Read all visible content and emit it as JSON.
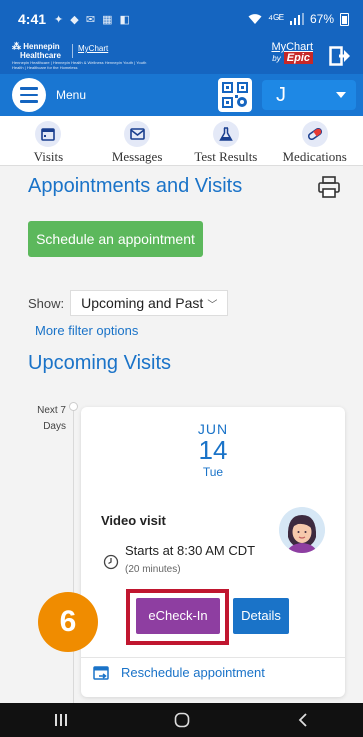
{
  "status_bar": {
    "time": "4:41",
    "notification_glyphs": "✦ ◆ ✉ ▦ ◧",
    "network": "⁴ᴳᴱ",
    "battery": "67%"
  },
  "brand": {
    "org_name_line1": "Hennepin",
    "org_name_line2": "Healthcare",
    "mychart_link": "MyChart",
    "tagline": "Hennepin Healthcare | Hennepin Health & Wellness Hennepin Youth | Youth Health | Healthcare for the Homeless",
    "mychart_logo_text": "MyChart",
    "mychart_logo_by": "by",
    "mychart_logo_epic": "Epic"
  },
  "menu_bar": {
    "menu_label": "Menu",
    "user_initial": "J"
  },
  "shortcuts": [
    {
      "label": "Visits",
      "icon": "calendar-icon"
    },
    {
      "label": "Messages",
      "icon": "envelope-icon"
    },
    {
      "label": "Test Results",
      "icon": "flask-icon"
    },
    {
      "label": "Medications",
      "icon": "pill-icon"
    }
  ],
  "page": {
    "title": "Appointments and Visits",
    "schedule_button": "Schedule an appointment",
    "show_label": "Show:",
    "show_value": "Upcoming and Past",
    "filter_link": "More filter options",
    "upcoming_title": "Upcoming Visits"
  },
  "timeline": {
    "label_line1": "Next 7",
    "label_line2": "Days"
  },
  "visit": {
    "month": "JUN",
    "day": "14",
    "weekday": "Tue",
    "type": "Video visit",
    "start_time": "Starts at 8:30 AM CDT",
    "duration": "(20 minutes)",
    "echeckin_button": "eCheck-In",
    "details_button": "Details",
    "reschedule_link": "Reschedule appointment"
  },
  "annotation": {
    "step_number": "6",
    "highlight_color": "#c0162f",
    "badge_color": "#f08c00"
  },
  "colors": {
    "header_blue": "#1565c0",
    "link_blue": "#1a73c8",
    "schedule_green": "#5cb85c",
    "echeckin_purple": "#8e3ea1"
  }
}
